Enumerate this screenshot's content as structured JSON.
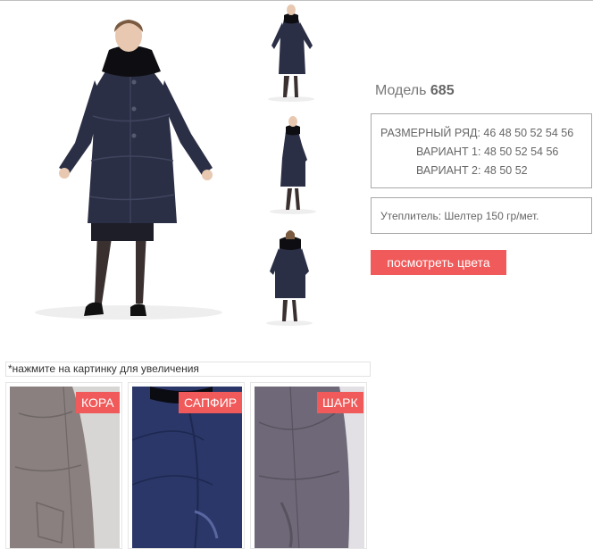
{
  "product": {
    "model_label": "Модель",
    "model_number": "685"
  },
  "sizes": {
    "range": "РАЗМЕРНЫЙ РЯД: 46 48 50 52 54 56",
    "variant1": "ВАРИАНТ 1: 48 50 52 54 56",
    "variant2": "ВАРИАНТ 2: 48 50 52"
  },
  "insulation": "Утеплитель: Шелтер 150 гр/мет.",
  "colors_button": "посмотреть цвета",
  "hint": "*нажмите на картинку для увеличения",
  "swatches": [
    {
      "name": "КОРА",
      "color": "#8a8080"
    },
    {
      "name": "САПФИР",
      "color": "#2a3768"
    },
    {
      "name": "ШАРК",
      "color": "#6e6878"
    }
  ],
  "coat_color": "#2b2f45",
  "accent_color": "#f05a5a"
}
